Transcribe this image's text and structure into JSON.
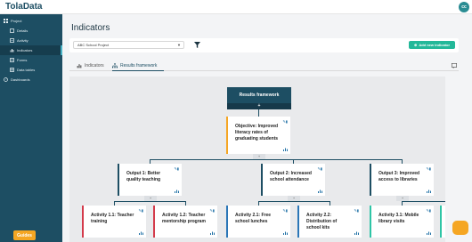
{
  "app": {
    "logo": "TolaData",
    "user_initials": "cc"
  },
  "sidebar": {
    "items": [
      {
        "label": "Project",
        "level": 0,
        "icon": "grid-icon"
      },
      {
        "label": "Details",
        "level": 1,
        "icon": "info-icon"
      },
      {
        "label": "Activity",
        "level": 1,
        "icon": "list-icon"
      },
      {
        "label": "Indicators",
        "level": 1,
        "icon": "chart-icon",
        "active": true
      },
      {
        "label": "Forms",
        "level": 1,
        "icon": "form-icon"
      },
      {
        "label": "Data tables",
        "level": 1,
        "icon": "table-icon"
      },
      {
        "label": "Dashboards",
        "level": 0,
        "icon": "dashboard-icon"
      }
    ],
    "guides_label": "Guides"
  },
  "page": {
    "title": "Indicators"
  },
  "filter": {
    "project_value": "ABC School Project",
    "add_button_label": "Add new indicator"
  },
  "tabs": [
    {
      "label": "Indicators",
      "active": false
    },
    {
      "label": "Results framework",
      "active": true
    }
  ],
  "framework": {
    "root": {
      "label": "Results framework"
    },
    "objective": {
      "label": "Objective: Improved literacy rates of graduating students"
    },
    "outputs": [
      {
        "label": "Output 1: Better quality teaching"
      },
      {
        "label": "Output 2: Increased school attendance"
      },
      {
        "label": "Output 3: Improved access to libraries"
      }
    ],
    "activities": [
      {
        "label": "Activity 1.1: Teacher training",
        "color": "#d43b4b"
      },
      {
        "label": "Activity 1.2: Teacher mentorship program",
        "color": "#d43b4b"
      },
      {
        "label": "Activity 2.1: Free school lunches",
        "color": "#2a76b7"
      },
      {
        "label": "Activity 2.2: Distribution of school kits",
        "color": "#2a76b7"
      },
      {
        "label": "Activity 3.1: Mobile library visits",
        "color": "#2ec5a6"
      }
    ]
  },
  "colors": {
    "sidebar": "#1d4e63",
    "accent": "#23b899",
    "guides": "#f5a623"
  }
}
